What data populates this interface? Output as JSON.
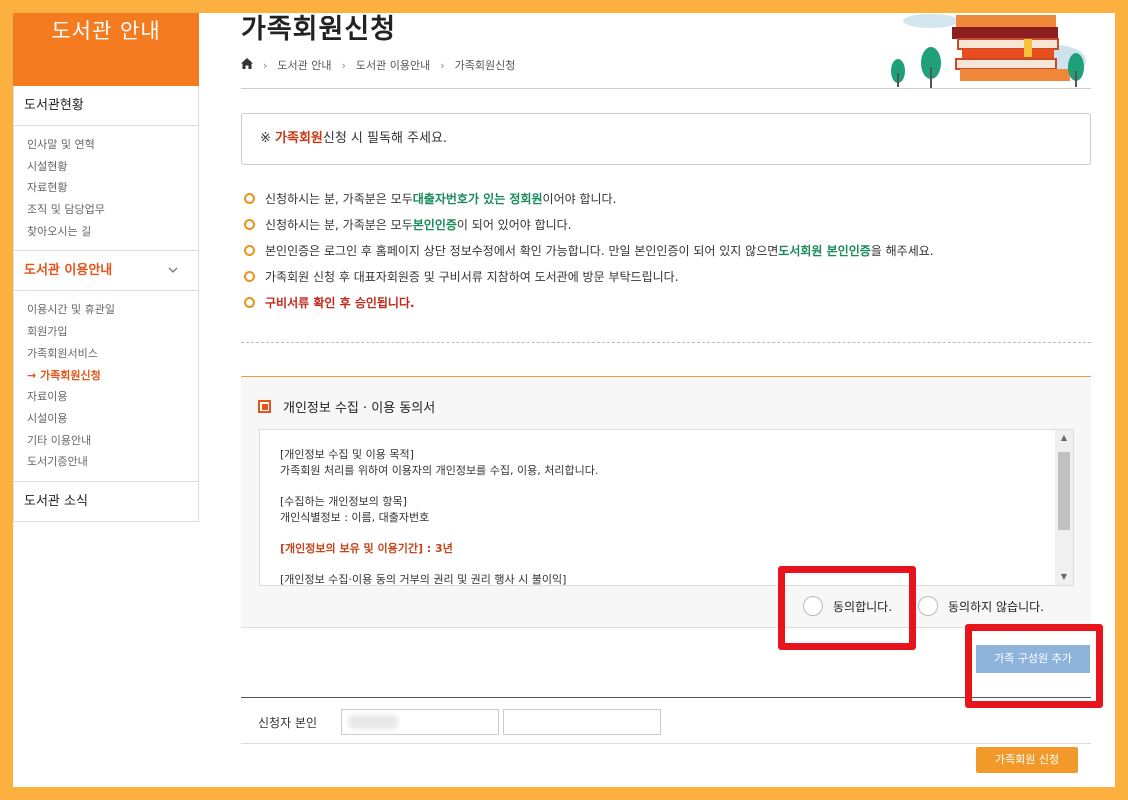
{
  "sidebar": {
    "header": "도서관 안내",
    "sections": [
      {
        "label": "도서관현황",
        "active": false,
        "items": [
          "인사말 및 연혁",
          "시설현황",
          "자료현황",
          "조직 및 담당업무",
          "찾아오시는 길"
        ]
      },
      {
        "label": "도서관 이용안내",
        "active": true,
        "items": [
          "이용시간 및 휴관일",
          "회원가입",
          "가족회원서비스",
          "→ 가족회원신청",
          "자료이용",
          "시설이용",
          "기타 이용안내",
          "도서기증안내"
        ]
      },
      {
        "label": "도서관 소식",
        "active": false,
        "items": []
      }
    ]
  },
  "page": {
    "title": "가족회원신청",
    "breadcrumb": [
      "도서관 안내",
      "도서관 이용안내",
      "가족회원신청"
    ],
    "notice": {
      "prefix": "※ ",
      "highlight": "가족회원",
      "suffix": "신청 시 필독해 주세요."
    },
    "rules": [
      {
        "pre": "신청하시는 분, 가족분은 모두 ",
        "hl": "대출자번호가 있는 정회원",
        "post": "이어야 합니다."
      },
      {
        "pre": "신청하시는 분, 가족분은 모두 ",
        "hl": "본인인증",
        "post": "이 되어 있어야 합니다."
      },
      {
        "pre": "본인인증은 로그인 후 홈페이지 상단 정보수정에서 확인 가능합니다. 만일 본인인증이 되어 있지 않으면 ",
        "hl": "도서회원 본인인증",
        "post": "을 해주세요."
      },
      {
        "pre": "가족회원 신청 후 대표자회원증 및 구비서류 지참하여 도서관에 방문 부탁드립니다.",
        "hl": "",
        "post": ""
      },
      {
        "pre": "구비서류 확인 후 승인됩니다.",
        "hl": "",
        "post": ""
      }
    ]
  },
  "consent": {
    "title": "개인정보 수집 · 이용 동의서",
    "terms": {
      "p1_title": "[개인정보 수집 및 이용 목적]",
      "p1_body": "가족회원 처리를 위하여 이용자의 개인정보를 수집, 이용, 처리합니다.",
      "p2_title": "[수집하는 개인정보의 항목]",
      "p2_body": "개인식별정보 : 이름, 대출자번호",
      "p3": "[개인정보의 보유 및 이용기간] : 3년",
      "p4": "[개인정보 수집·이용 동의 거부의 권리 및 권리 행사 시 불이익]"
    },
    "agree_label": "동의합니다.",
    "disagree_label": "동의하지 않습니다."
  },
  "buttons": {
    "add_member": "가족 구성원 추가",
    "apply": "가족회원 신청"
  },
  "applicant": {
    "label": "신청자 본인"
  },
  "colors": {
    "accent_orange": "#f47b20",
    "frame": "#fcb040",
    "highlight_red": "#e8141c",
    "green": "#1a8a5a"
  }
}
